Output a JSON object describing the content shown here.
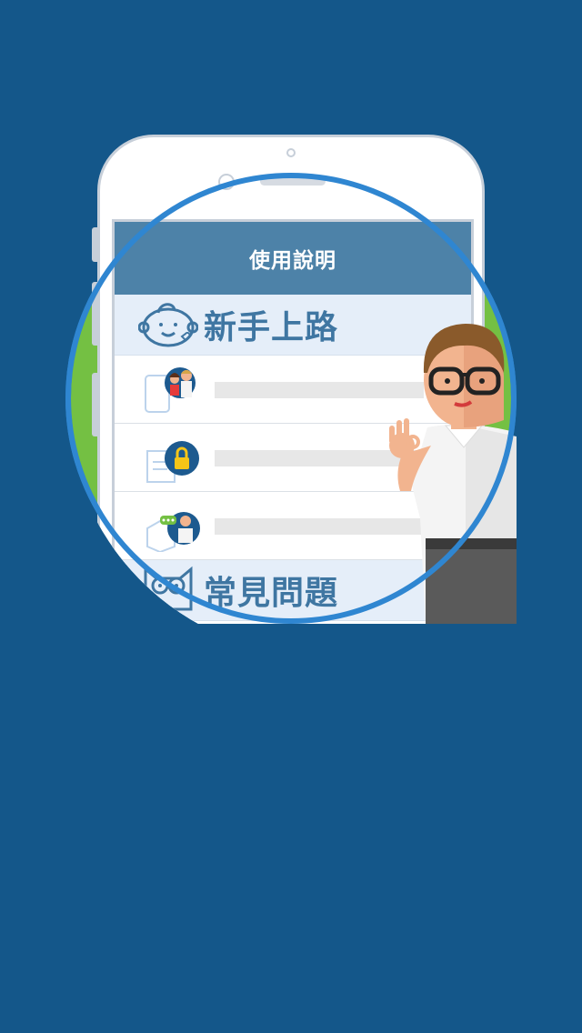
{
  "header": {
    "title": "使用說明"
  },
  "sections": [
    {
      "label": "新手上路",
      "icon": "baby-face-icon"
    },
    {
      "label": "常見問題",
      "icon": "owl-icon"
    }
  ],
  "rows": [
    {
      "icon": "family-avatar-icon"
    },
    {
      "icon": "lock-icon"
    },
    {
      "icon": "support-agent-icon"
    }
  ],
  "colors": {
    "background": "#14578a",
    "circle": "#74c043",
    "circle_border": "#2f86d1",
    "header": "#4d82a8",
    "section_bg": "#e5eef9",
    "section_text": "#3f76a2"
  }
}
